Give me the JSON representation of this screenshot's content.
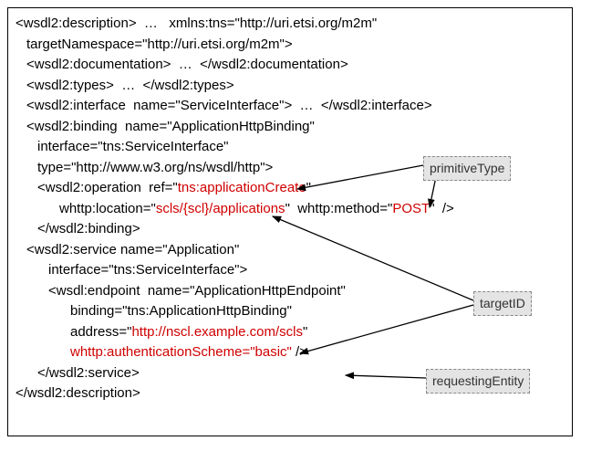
{
  "lines": {
    "l1a": "<wsdl2:description>  …   xmlns:tns=\"http://uri.etsi.org/m2m\"",
    "l2": "targetNamespace=\"http://uri.etsi.org/m2m\">",
    "l3": "<wsdl2:documentation>  …  </wsdl2:documentation>",
    "l4": "<wsdl2:types>  …  </wsdl2:types>",
    "l5": "<wsdl2:interface  name=\"ServiceInterface\">  …  </wsdl2:interface>",
    "l6": "<wsdl2:binding  name=\"ApplicationHttpBinding\"",
    "l7": "interface=\"tns:ServiceInterface\"",
    "l8": "type=\"http://www.w3.org/ns/wsdl/http\">",
    "l9a": "<wsdl2:operation  ref=\"",
    "l9b": "tns:applicationCreate",
    "l9c": "\"",
    "l10a": "whttp:location=\"",
    "l10b": "scls/{scl}/applications",
    "l10c": "\"  whttp:method=\"",
    "l10d": "POST",
    "l10e": "\"  />",
    "l11": "</wsdl2:binding>",
    "l12": "<wsdl2:service name=\"Application\"",
    "l13": "interface=\"tns:ServiceInterface\">",
    "l14": "<wsdl:endpoint  name=\"ApplicationHttpEndpoint\"",
    "l15": "binding=\"tns:ApplicationHttpBinding\"",
    "l16a": "address=\"",
    "l16b": "http://nscl.example.com/scls",
    "l16c": "\"",
    "l17a": "whttp:authenticationScheme=\"basic\"",
    "l17b": " />",
    "l18": "</wsdl2:service>",
    "l19": "</wsdl2:description>"
  },
  "labels": {
    "primitiveType": "primitiveType",
    "targetID": "targetID",
    "requestingEntity": "requestingEntity"
  }
}
